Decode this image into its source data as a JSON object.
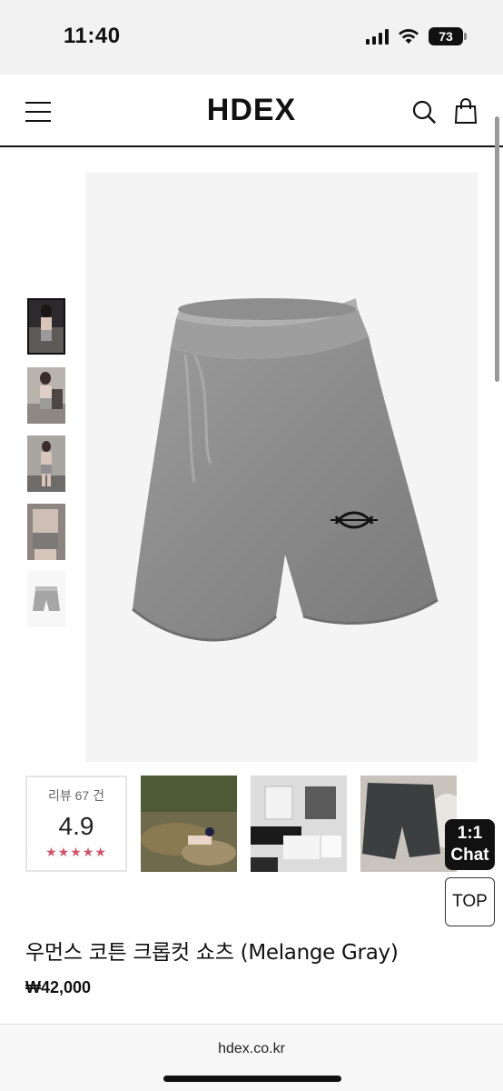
{
  "status_bar": {
    "time": "11:40",
    "battery": "73"
  },
  "header": {
    "logo": "HDEX"
  },
  "icons": {
    "menu": "hamburger-menu-icon",
    "search": "search-icon",
    "cart": "shopping-bag-icon"
  },
  "gallery": {
    "main_image": "gray-cotton-shorts-photo",
    "thumbnails": [
      "model-photo-1",
      "model-photo-2",
      "model-photo-3",
      "model-photo-4",
      "product-shorts-photo"
    ]
  },
  "reviews": {
    "count_label": "리뷰 67 건",
    "score": "4.9",
    "stars": "★★★★★",
    "star_color": "#d0546a"
  },
  "floating": {
    "chat_line1": "1:1",
    "chat_line2": "Chat",
    "top": "TOP"
  },
  "product": {
    "title": "우먼스 코튼 크롭컷 쇼츠 (Melange Gray)",
    "price": "₩42,000"
  },
  "browser": {
    "url": "hdex.co.kr"
  }
}
